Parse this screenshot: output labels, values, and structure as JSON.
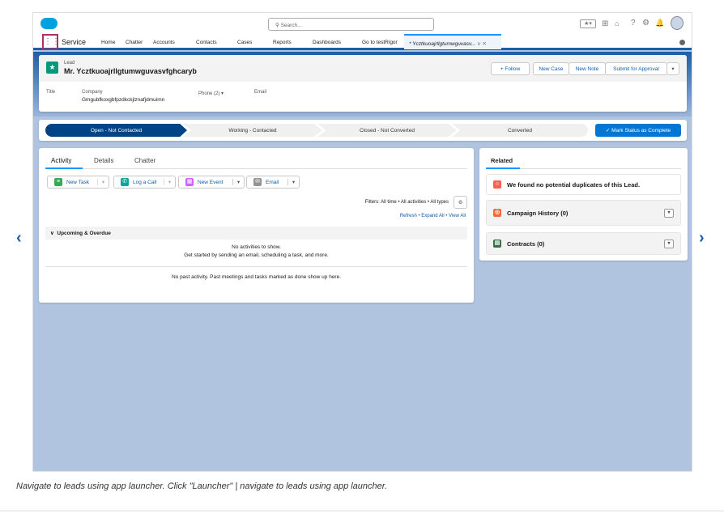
{
  "header": {
    "search_placeholder": "Search..."
  },
  "nav": {
    "app_name": "Service",
    "items": [
      "Home",
      "Chatter",
      "Accounts",
      "Contacts",
      "Cases",
      "Reports",
      "Dashboards",
      "Go to testRigor"
    ],
    "active_tab": "* Ycztkuoajrllgtumwguvasv..."
  },
  "record": {
    "object": "Lead",
    "name": "Mr. Ycztkuoajrllgtumwguvasvfghcaryb",
    "actions": [
      "+ Follow",
      "New Case",
      "New Note",
      "Submit for Approval"
    ],
    "fields": {
      "title_label": "Title",
      "company_label": "Company",
      "company_value": "Gmgubfkoxgbfpzdkckjlznafjdmuimn",
      "phone_label": "Phone (2)",
      "email_label": "Email"
    }
  },
  "path": {
    "stages": [
      "Open - Not Contacted",
      "Working - Contacted",
      "Closed - Not Converted",
      "Converted"
    ],
    "mark_complete": "Mark Status as Complete"
  },
  "activity": {
    "tabs": [
      "Activity",
      "Details",
      "Chatter"
    ],
    "buttons": [
      "New Task",
      "Log a Call",
      "New Event",
      "Email"
    ],
    "filters": "Filters: All time • All activities • All types",
    "links": [
      "Refresh",
      "Expand All",
      "View All"
    ],
    "section": "Upcoming & Overdue",
    "empty1": "No activities to show.",
    "empty2": "Get started by sending an email, scheduling a task, and more.",
    "past": "No past activity. Past meetings and tasks marked as done show up here."
  },
  "related": {
    "tab": "Related",
    "duplicates": "We found no potential duplicates of this Lead.",
    "campaign": "Campaign History (0)",
    "contracts": "Contracts (0)"
  },
  "caption": "Navigate to leads using app launcher. Click \"Launcher\" | navigate to leads using app launcher."
}
